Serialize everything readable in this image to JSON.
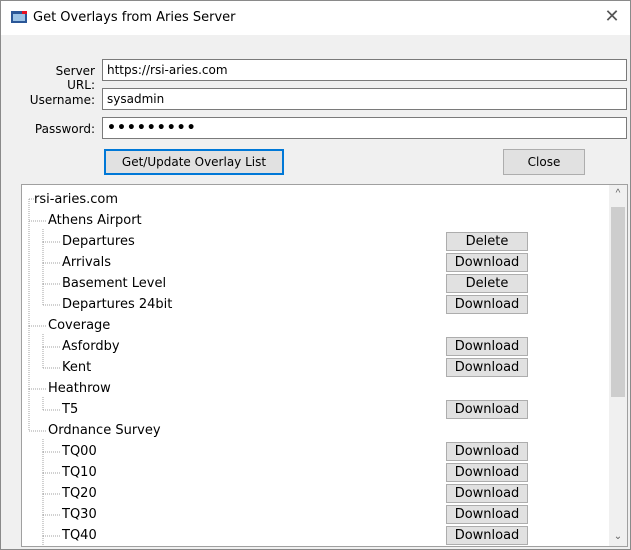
{
  "window": {
    "title": "Get Overlays from Aries Server",
    "close_glyph": "✕",
    "icon": "app-window-icon"
  },
  "form": {
    "server_url_label": "Server URL:",
    "server_url_value": "https://rsi-aries.com",
    "username_label": "Username:",
    "username_value": "sysadmin",
    "password_label": "Password:",
    "password_value": "•••••••••"
  },
  "buttons": {
    "get_update": "Get/Update Overlay List",
    "close": "Close"
  },
  "tree": {
    "root": "rsi-aries.com",
    "rows": [
      {
        "label": "Athens Airport",
        "level": 1,
        "button": ""
      },
      {
        "label": "Departures",
        "level": 2,
        "button": "Delete"
      },
      {
        "label": "Arrivals",
        "level": 2,
        "button": "Download"
      },
      {
        "label": "Basement Level",
        "level": 2,
        "button": "Delete"
      },
      {
        "label": "Departures 24bit",
        "level": 2,
        "button": "Download"
      },
      {
        "label": "Coverage",
        "level": 1,
        "button": ""
      },
      {
        "label": "Asfordby",
        "level": 2,
        "button": "Download"
      },
      {
        "label": "Kent",
        "level": 2,
        "button": "Download"
      },
      {
        "label": "Heathrow",
        "level": 1,
        "button": ""
      },
      {
        "label": "T5",
        "level": 2,
        "button": "Download"
      },
      {
        "label": "Ordnance Survey",
        "level": 1,
        "button": ""
      },
      {
        "label": "TQ00",
        "level": 2,
        "button": "Download"
      },
      {
        "label": "TQ10",
        "level": 2,
        "button": "Download"
      },
      {
        "label": "TQ20",
        "level": 2,
        "button": "Download"
      },
      {
        "label": "TQ30",
        "level": 2,
        "button": "Download"
      },
      {
        "label": "TQ40",
        "level": 2,
        "button": "Download"
      }
    ]
  },
  "scrollbar": {
    "up_glyph": "^",
    "down_glyph": "⌄"
  },
  "colors": {
    "accent": "#0078d7",
    "window_bg": "#f0f0f0"
  }
}
